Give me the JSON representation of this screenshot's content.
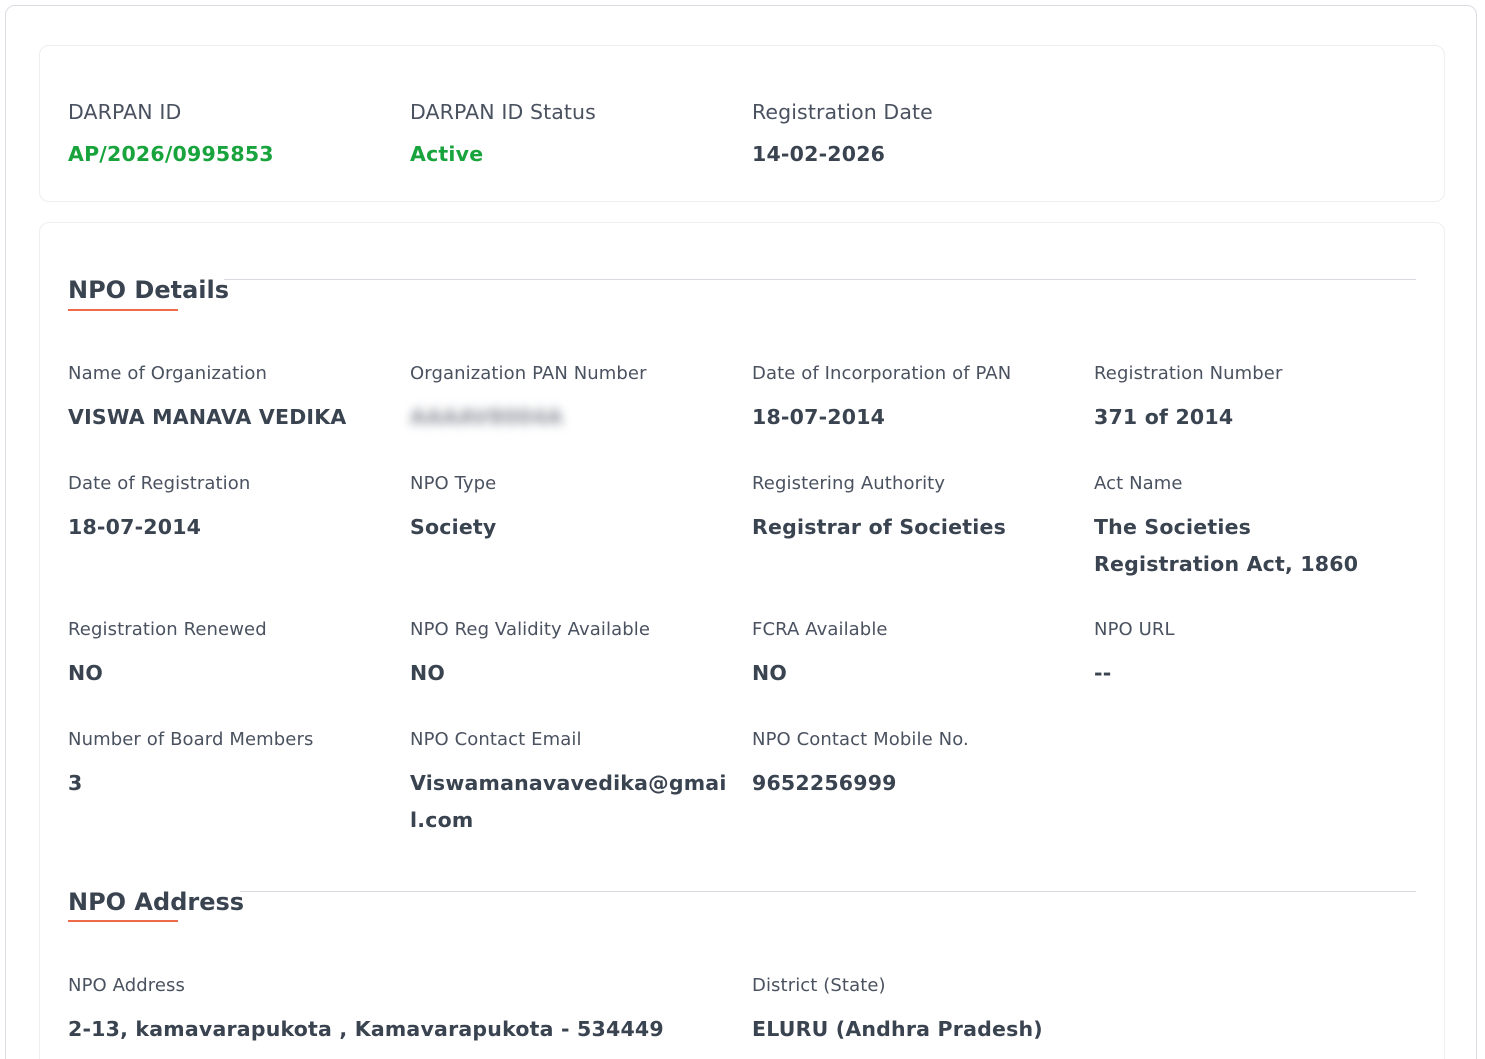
{
  "summary": {
    "darpan_id": {
      "label": "DARPAN ID",
      "value": "AP/2026/0995853"
    },
    "status": {
      "label": "DARPAN ID Status",
      "value": "Active"
    },
    "registration_date": {
      "label": "Registration Date",
      "value": "14-02-2026"
    }
  },
  "npo_details": {
    "title": "NPO Details",
    "fields": [
      {
        "label": "Name of Organization",
        "value": "VISWA MANAVA VEDIKA"
      },
      {
        "label": "Organization PAN Number",
        "value": "AAAAV8004A"
      },
      {
        "label": "Date of Incorporation of PAN",
        "value": "18-07-2014"
      },
      {
        "label": "Registration Number",
        "value": "371 of 2014"
      },
      {
        "label": "Date of Registration",
        "value": "18-07-2014"
      },
      {
        "label": "NPO Type",
        "value": "Society"
      },
      {
        "label": "Registering Authority",
        "value": "Registrar of Societies"
      },
      {
        "label": "Act Name",
        "value": "The Societies Registration Act, 1860"
      },
      {
        "label": "Registration Renewed",
        "value": "NO"
      },
      {
        "label": "NPO Reg Validity Available",
        "value": "NO"
      },
      {
        "label": "FCRA Available",
        "value": "NO"
      },
      {
        "label": "NPO URL",
        "value": "--"
      },
      {
        "label": "Number of Board Members",
        "value": "3"
      },
      {
        "label": "NPO Contact Email",
        "value": "Viswamanavavedika@gmail.com"
      },
      {
        "label": "NPO Contact Mobile No.",
        "value": "9652256999"
      }
    ]
  },
  "npo_address": {
    "title": "NPO Address",
    "address": {
      "label": "NPO Address",
      "value": "2-13, kamavarapukota , Kamavarapukota - 534449"
    },
    "district": {
      "label": "District (State)",
      "value": "ELURU (Andhra Pradesh)"
    }
  }
}
